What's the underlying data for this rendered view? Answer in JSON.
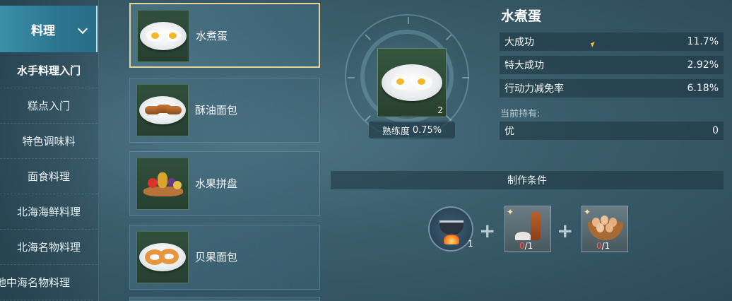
{
  "nav": {
    "header": "料理",
    "items": [
      "水手料理入门",
      "糕点入门",
      "特色调味料",
      "面食料理",
      "北海海鲜料理",
      "北海名物料理",
      "地中海名物料理"
    ],
    "active_index": 0
  },
  "recipes": [
    {
      "name": "水煮蛋",
      "icon": "boiled-egg-icon",
      "selected": true
    },
    {
      "name": "酥油面包",
      "icon": "butter-bread-icon",
      "selected": false
    },
    {
      "name": "水果拼盘",
      "icon": "fruit-platter-icon",
      "selected": false
    },
    {
      "name": "贝果面包",
      "icon": "bagel-icon",
      "selected": false
    }
  ],
  "detail": {
    "title": "水煮蛋",
    "item_count": "2",
    "proficiency_label": "熟练度",
    "proficiency_value": "0.75%",
    "stats": [
      {
        "label": "大成功",
        "value": "11.7%"
      },
      {
        "label": "特大成功",
        "value": "2.92%"
      },
      {
        "label": "行动力减免率",
        "value": "6.18%"
      }
    ],
    "held_label": "当前持有:",
    "held": {
      "label": "优",
      "value": "0"
    },
    "conditions_label": "制作条件",
    "tool": {
      "icon": "cooking-pot-icon",
      "count": "1"
    },
    "ingredients": [
      {
        "icon": "salt-pepper-icon",
        "have": "0",
        "need": "/1"
      },
      {
        "icon": "eggs-basket-icon",
        "have": "0",
        "need": "/1"
      }
    ],
    "plus": "+"
  },
  "colors": {
    "selected_border": "#e4d49a",
    "nav_header": "#2b7590",
    "held_green": "#7fd38a",
    "missing_red": "#ff5a4a"
  }
}
